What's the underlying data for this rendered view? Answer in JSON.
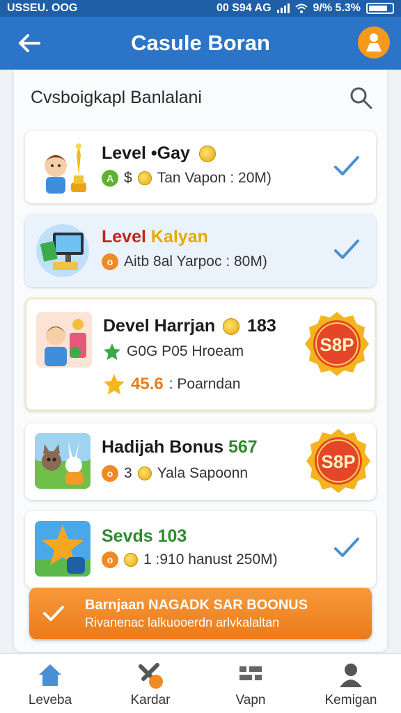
{
  "status_bar": {
    "left": "USSEU. OOG",
    "right": "00 S94 AG",
    "battery": "9/% 5.3%"
  },
  "app_bar": {
    "title": "Casule Boran"
  },
  "list_header": {
    "title": "Cvsboigkapl Banlalani"
  },
  "cards": [
    {
      "title": "Level •Gay",
      "subtitle": "Tan Vapon : 20M)",
      "sub_prefix": "$"
    },
    {
      "title_a": "Level",
      "title_b": "Kalyan",
      "subtitle": "Aitb 8al Yarpoc : 80M)"
    },
    {
      "title": "Devel Harrjan",
      "title_num": "183",
      "subtitle": "G0G P05 Hroeam",
      "rating": "45.6",
      "rating_label": ": Poarndan",
      "badge": "S8P"
    },
    {
      "title": "Hadijah Bonus",
      "title_num": "567",
      "subtitle": "Yala Sapoonn",
      "sub_prefix": "3",
      "badge": "S8P"
    },
    {
      "title": "Sevds 103",
      "subtitle": "1 :910 hanust 250M)"
    }
  ],
  "promo_banner": {
    "line1": "Barnjaan NAGADK SAR BOONUS",
    "line2": "Rivanenac lalkuooerdn arlvkalaltan"
  },
  "bottom_nav": [
    {
      "label": "Leveba"
    },
    {
      "label": "Kardar"
    },
    {
      "label": "Vapn"
    },
    {
      "label": "Kemigan"
    }
  ],
  "colors": {
    "app_bar": "#2b74c7",
    "accent_orange": "#ec7a1a",
    "check_blue": "#4b8fd6",
    "green_text": "#2e8b2e",
    "red_text": "#c0261c"
  }
}
